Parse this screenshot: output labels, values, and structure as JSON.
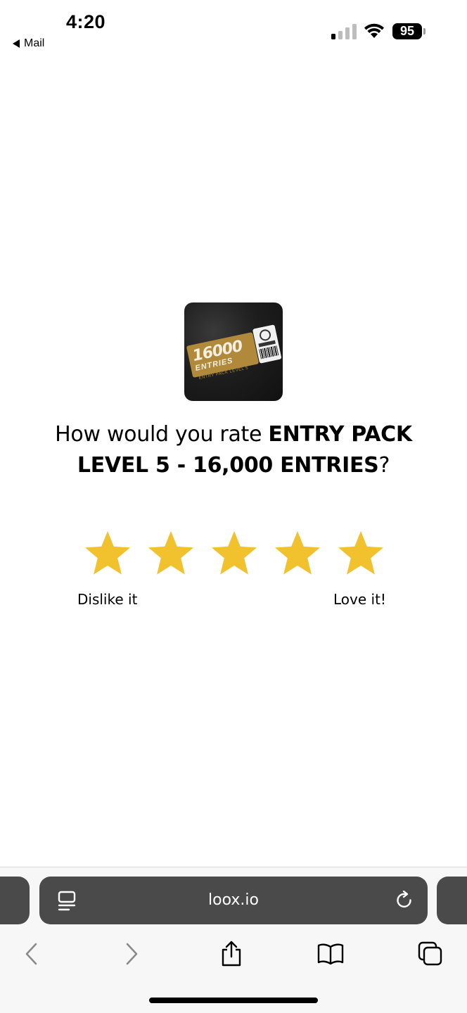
{
  "status_bar": {
    "time": "4:20",
    "back_app": "Mail",
    "battery": "95"
  },
  "question": {
    "prefix": "How would you rate ",
    "product_name": "ENTRY PACK LEVEL 5 - 16,000 ENTRIES",
    "suffix": "?"
  },
  "product_image": {
    "ticket_number": "16000",
    "ticket_word": "ENTRIES",
    "ticket_subtitle": "ENTRY PACK LEVEL 5"
  },
  "rating": {
    "star_count": 5,
    "star_color": "#F2C12E",
    "label_low": "Dislike it",
    "label_high": "Love it!"
  },
  "browser": {
    "url": "loox.io",
    "bar_color": "#4A4A4A"
  },
  "icons": {
    "reader": "reader-icon",
    "reload": "reload-icon",
    "back": "chevron-left-icon",
    "forward": "chevron-right-icon",
    "share": "share-icon",
    "bookmarks": "book-icon",
    "tabs": "tabs-icon"
  }
}
